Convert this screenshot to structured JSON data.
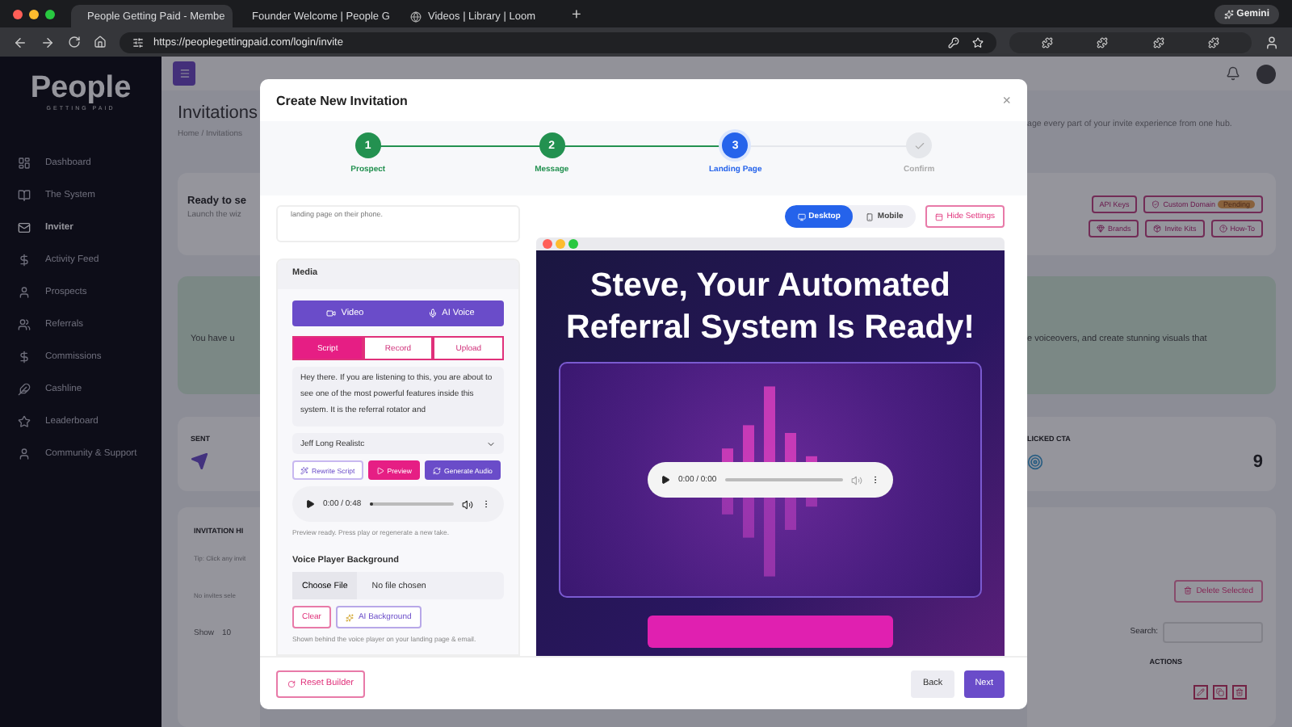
{
  "browser": {
    "tabs": [
      {
        "title": "People Getting Paid - Membe",
        "selected": true
      },
      {
        "title": "Founder Welcome | People G",
        "selected": false
      },
      {
        "title": "Videos | Library | Loom",
        "selected": false
      }
    ],
    "new_tab": "+",
    "profile_button": "Gemini",
    "address": "https://peoplegettingpaid.com/login/invite"
  },
  "sidebar": {
    "logo": "People",
    "tagline": "GETTING PAID",
    "items": [
      {
        "label": "Dashboard",
        "selected": false
      },
      {
        "label": "The System",
        "selected": false
      },
      {
        "label": "Inviter",
        "selected": true
      },
      {
        "label": "Activity Feed",
        "selected": false
      },
      {
        "label": "Prospects",
        "selected": false
      },
      {
        "label": "Referrals",
        "selected": false
      },
      {
        "label": "Commissions",
        "selected": false
      },
      {
        "label": "Cashline",
        "selected": false
      },
      {
        "label": "Leaderboard",
        "selected": false
      },
      {
        "label": "Community & Support",
        "selected": false
      }
    ]
  },
  "page": {
    "title": "Invitations",
    "breadcrumb": "Home / Invitations",
    "subtitle_tail": "age every part of your invite experience from one hub.",
    "wizard_card": {
      "title": "Ready to se",
      "text": "Launch the wiz",
      "buttons": [
        {
          "label": "API Keys"
        },
        {
          "label": "Custom Domain",
          "badge": "Pending"
        },
        {
          "label": "Brands"
        },
        {
          "label": "Invite Kits"
        },
        {
          "label": "How-To"
        }
      ]
    },
    "notice": {
      "text_start": "You have u",
      "text_end": "e voiceovers, and create stunning visuals that"
    },
    "stats": {
      "sent_label": "SENT",
      "clicked_label": "LICKED CTA",
      "clicked_value": "9"
    },
    "history": {
      "title": "INVITATION HI",
      "tip": "Tip: Click any invit",
      "selection": "No invites sele",
      "show_label": "Show",
      "page_size": "10",
      "delete_button": "Delete Selected",
      "search_label": "Search:",
      "actions_header": "ACTIONS"
    }
  },
  "modal": {
    "title": "Create New Invitation",
    "close": "×",
    "steps": [
      {
        "number": "1",
        "label": "Prospect",
        "completed": true,
        "current": false
      },
      {
        "number": "2",
        "label": "Message",
        "completed": true,
        "current": false
      },
      {
        "number": "3",
        "label": "Landing Page",
        "completed": false,
        "current": true
      },
      {
        "label": "Confirm",
        "completed": false,
        "current": false
      }
    ],
    "info_text": "landing page on their phone.",
    "view_toggle": [
      {
        "label": "Desktop",
        "selected": true
      },
      {
        "label": "Mobile",
        "selected": false
      }
    ],
    "hide_settings": "Hide Settings",
    "media": {
      "title": "Media",
      "source_tabs": [
        {
          "label": "Video"
        },
        {
          "label": "AI Voice"
        }
      ],
      "script_tabs": [
        {
          "label": "Script",
          "selected": true
        },
        {
          "label": "Record",
          "selected": false
        },
        {
          "label": "Upload",
          "selected": false
        }
      ],
      "script": "Hey there. If you are listening to this, you are about to see one of the most powerful features inside this system. It is the referral rotator and",
      "voice": "Jeff Long Realistc",
      "actions": [
        {
          "label": "Rewrite Script",
          "kind": "outline"
        },
        {
          "label": "Preview",
          "kind": "pink"
        },
        {
          "label": "Generate Audio",
          "kind": "purple"
        }
      ],
      "player": {
        "time": "0:00 / 0:48",
        "level": 0.05
      },
      "player_note": "Preview ready. Press play or regenerate a new take.",
      "background_title": "Voice Player Background",
      "file_button": "Choose File",
      "file_status": "No file chosen",
      "background_buttons": [
        {
          "label": "Clear",
          "kind": "pink"
        },
        {
          "label": "AI Background",
          "kind": "purple"
        }
      ],
      "background_note": "Shown behind the voice player on your landing page & email."
    },
    "preview": {
      "headline": "Steve, Your Automated Referral System Is Ready!",
      "player": {
        "time": "0:00 / 0:00"
      }
    },
    "footer": {
      "reset": "Reset Builder",
      "back": "Back",
      "next": "Next"
    }
  }
}
